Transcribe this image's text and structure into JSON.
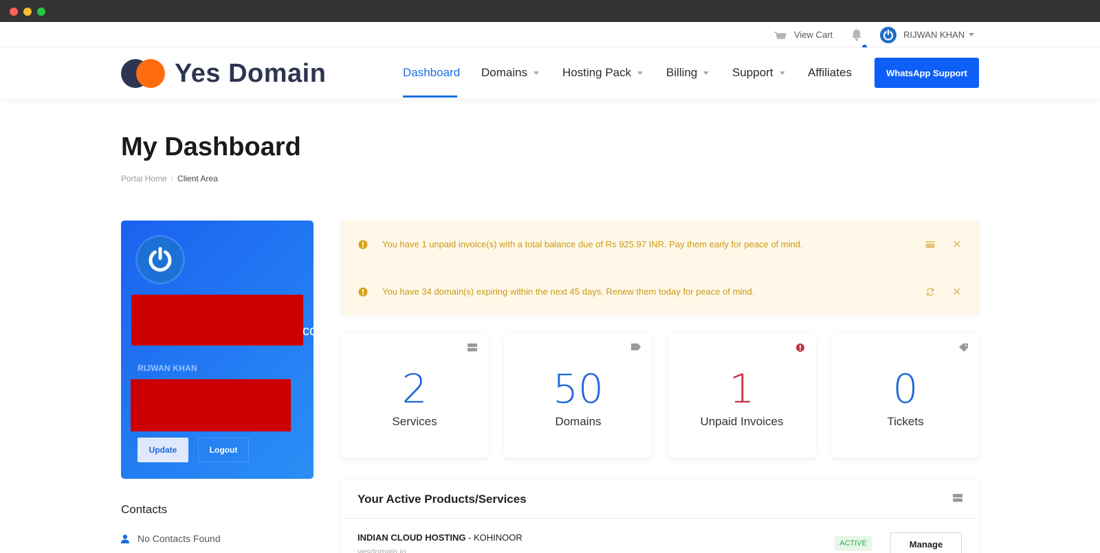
{
  "colors": {
    "brand_blue": "#1a6fe0",
    "whatsapp_button": "#0d5ff7",
    "logo_dark": "#2e3550",
    "logo_orange": "#ff6b10",
    "alert_text": "#c99a16",
    "unpaid_red": "#c43347",
    "active_green": "#2fa84f"
  },
  "topbar": {
    "cart_label": "View Cart",
    "cart_icon": "basket-icon",
    "bell_icon": "bell-icon",
    "user_name": "RIJWAN KHAN"
  },
  "header": {
    "logo_text": "Yes Domain",
    "nav": [
      {
        "label": "Dashboard",
        "active": true
      },
      {
        "label": "Domains",
        "dropdown": true
      },
      {
        "label": "Hosting Pack",
        "dropdown": true
      },
      {
        "label": "Billing",
        "dropdown": true
      },
      {
        "label": "Support",
        "dropdown": true
      },
      {
        "label": "Affiliates"
      }
    ],
    "cta_label": "WhatsApp Support"
  },
  "page": {
    "title": "My Dashboard",
    "breadcrumb": [
      "Portal Home",
      "/",
      "Client Area"
    ]
  },
  "profile": {
    "overflow_text": "co",
    "name": "RIJWAN KHAN",
    "update_label": "Update",
    "logout_label": "Logout"
  },
  "contacts": {
    "title": "Contacts",
    "empty_text": "No Contacts Found"
  },
  "alerts": [
    {
      "text": "You have 1 unpaid invoice(s) with a total balance due of Rs 925.97 INR. Pay them early for peace of mind.",
      "action_icon": "wallet-icon"
    },
    {
      "text": "You have 34 domain(s) expiring within the next 45 days. Renew them today for peace of mind.",
      "action_icon": "renew-icon"
    }
  ],
  "stats": [
    {
      "value": "2",
      "label": "Services",
      "icon": "server-icon"
    },
    {
      "value": "50",
      "label": "Domains",
      "icon": "tag-icon"
    },
    {
      "value": "1",
      "label": "Unpaid Invoices",
      "icon": "alert-icon"
    },
    {
      "value": "0",
      "label": "Tickets",
      "icon": "ticket-icon"
    }
  ],
  "products": {
    "title": "Your Active Products/Services",
    "rows": [
      {
        "name": "INDIAN CLOUD HOSTING",
        "dash": " - ",
        "plan": "KOHINOOR",
        "domain": "yesdomain.io",
        "status": "ACTIVE",
        "action": "Manage"
      }
    ]
  }
}
